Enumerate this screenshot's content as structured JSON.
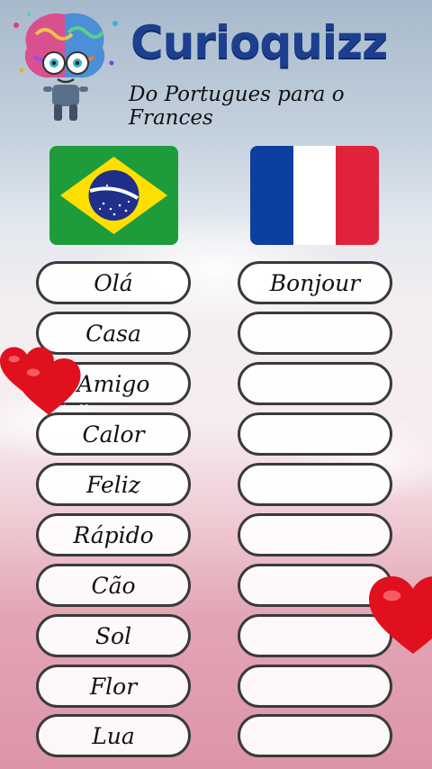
{
  "header": {
    "title": "Curioquizz",
    "subtitle": "Do Portugues para o Frances"
  },
  "flags": {
    "left": "brazil-flag",
    "right": "france-flag"
  },
  "words": {
    "portuguese": [
      "Olá",
      "Casa",
      "Amigo",
      "Calor",
      "Feliz",
      "Rápido",
      "Cão",
      "Sol",
      "Flor",
      "Lua"
    ],
    "french": [
      "Bonjour",
      "",
      "",
      "",
      "",
      "",
      "",
      "",
      "",
      ""
    ]
  },
  "watermark": "quizz.01",
  "colors": {
    "brand": "#1d3f8f",
    "brazil_green": "#1e9c3b",
    "brazil_yellow": "#fedf00",
    "brazil_blue": "#1f2f8a",
    "france_blue": "#0d3fa0",
    "france_red": "#e0223a",
    "heart": "#e0101e"
  }
}
